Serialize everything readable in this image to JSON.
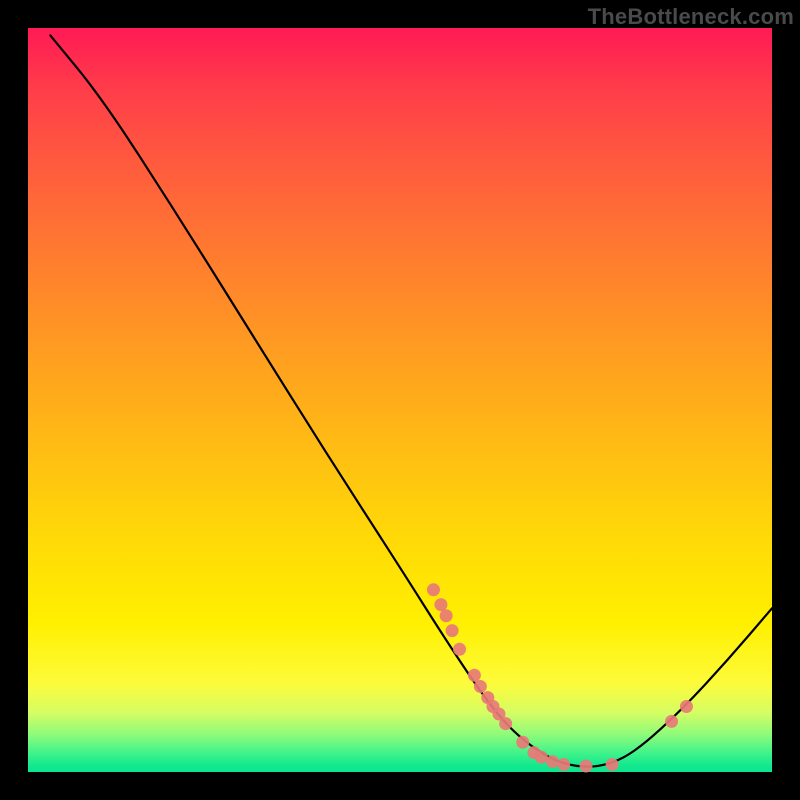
{
  "watermark": "TheBottleneck.com",
  "colors": {
    "curve_stroke": "#000000",
    "point_fill": "#e87a77",
    "background_black": "#000000"
  },
  "chart_data": {
    "type": "line",
    "title": "",
    "xlabel": "",
    "ylabel": "",
    "xlim": [
      0,
      100
    ],
    "ylim": [
      0,
      100
    ],
    "curve": [
      {
        "x": 3.0,
        "y": 99.0
      },
      {
        "x": 10.0,
        "y": 90.5
      },
      {
        "x": 20.0,
        "y": 75.0
      },
      {
        "x": 30.0,
        "y": 59.0
      },
      {
        "x": 40.0,
        "y": 43.0
      },
      {
        "x": 50.0,
        "y": 27.5
      },
      {
        "x": 56.0,
        "y": 18.0
      },
      {
        "x": 61.0,
        "y": 10.5
      },
      {
        "x": 65.0,
        "y": 5.5
      },
      {
        "x": 70.0,
        "y": 1.8
      },
      {
        "x": 74.0,
        "y": 0.6
      },
      {
        "x": 78.0,
        "y": 0.9
      },
      {
        "x": 82.0,
        "y": 3.0
      },
      {
        "x": 88.0,
        "y": 8.5
      },
      {
        "x": 94.0,
        "y": 15.0
      },
      {
        "x": 100.0,
        "y": 22.0
      }
    ],
    "points": [
      {
        "x": 54.5,
        "y": 24.5
      },
      {
        "x": 55.5,
        "y": 22.5
      },
      {
        "x": 56.2,
        "y": 21.0
      },
      {
        "x": 57.0,
        "y": 19.0
      },
      {
        "x": 58.0,
        "y": 16.5
      },
      {
        "x": 60.0,
        "y": 13.0
      },
      {
        "x": 60.8,
        "y": 11.5
      },
      {
        "x": 61.8,
        "y": 10.0
      },
      {
        "x": 62.5,
        "y": 8.8
      },
      {
        "x": 63.3,
        "y": 7.8
      },
      {
        "x": 64.2,
        "y": 6.5
      },
      {
        "x": 66.5,
        "y": 4.0
      },
      {
        "x": 68.0,
        "y": 2.6
      },
      {
        "x": 69.0,
        "y": 2.0
      },
      {
        "x": 70.5,
        "y": 1.4
      },
      {
        "x": 72.0,
        "y": 1.0
      },
      {
        "x": 75.0,
        "y": 0.8
      },
      {
        "x": 78.5,
        "y": 1.0
      },
      {
        "x": 86.5,
        "y": 6.8
      },
      {
        "x": 88.5,
        "y": 8.8
      }
    ]
  }
}
